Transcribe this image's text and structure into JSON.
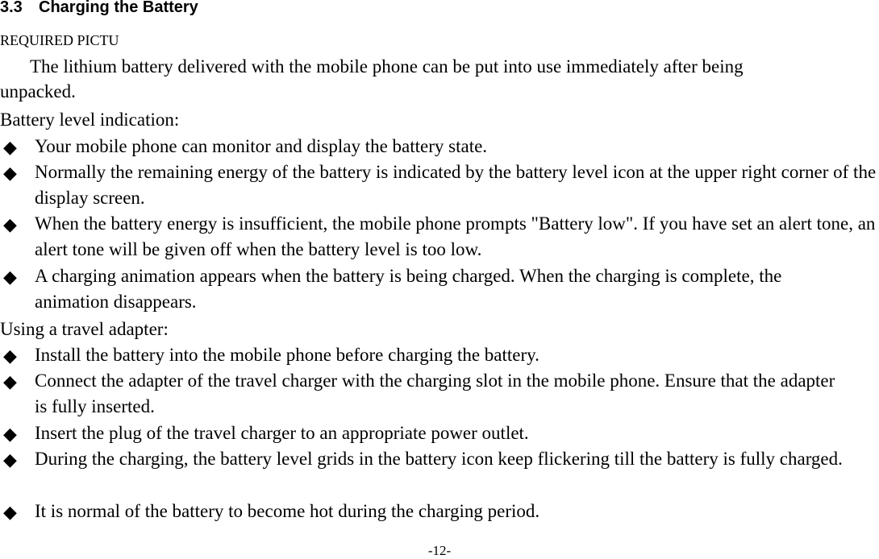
{
  "heading": {
    "number": "3.3",
    "title": "Charging the Battery"
  },
  "placeholder_text": "REQUIRED PICTU",
  "intro": {
    "line1": "The lithium battery delivered with the mobile phone can be put into use immediately after being",
    "line2": "unpacked."
  },
  "battery_level": {
    "label": "Battery level indication:",
    "items": [
      "Your mobile phone can monitor and display the battery state.",
      "Normally the remaining energy of the battery is indicated by the battery level icon at the upper right corner of the display screen.",
      "When the battery energy is insufficient, the mobile phone prompts \"Battery low\". If you have set an alert tone, an alert tone will be given off when the battery level is too low.",
      "A charging animation appears when the battery is being charged. When the charging is complete, the animation disappears."
    ]
  },
  "travel_adapter": {
    "label": "Using a travel adapter:",
    "items": [
      "Install the battery into the mobile phone before charging the battery.",
      "Connect the adapter of the travel charger with the charging slot in the mobile phone. Ensure that the adapter is fully inserted.",
      "Insert the plug of the travel charger to an appropriate power outlet.",
      "During the charging, the battery level grids in the battery icon keep flickering till the battery is fully charged.",
      "It is normal of the battery to become hot during the charging period."
    ]
  },
  "bullet_icon": "diamond-bullet",
  "footer": {
    "page_number": "-12-"
  }
}
